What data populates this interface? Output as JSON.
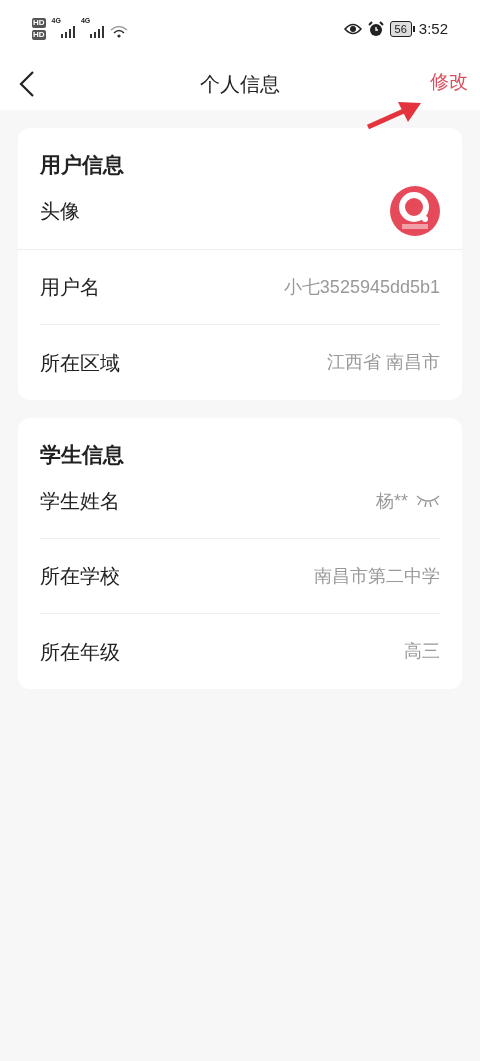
{
  "status_bar": {
    "sim_badges": [
      "HD",
      "HD"
    ],
    "networks": [
      "4G",
      "4G"
    ],
    "battery": "56",
    "time": "3:52"
  },
  "header": {
    "title": "个人信息",
    "action": "修改"
  },
  "sections": [
    {
      "title": "用户信息",
      "rows": [
        {
          "kind": "avatar",
          "label": "头像"
        },
        {
          "kind": "text",
          "label": "用户名",
          "value": "小七3525945dd5b1"
        },
        {
          "kind": "text",
          "label": "所在区域",
          "value": "江西省 南昌市"
        }
      ]
    },
    {
      "title": "学生信息",
      "rows": [
        {
          "kind": "masked",
          "label": "学生姓名",
          "value": "杨**",
          "revealed": false
        },
        {
          "kind": "text",
          "label": "所在学校",
          "value": "南昌市第二中学"
        },
        {
          "kind": "text",
          "label": "所在年级",
          "value": "高三"
        }
      ]
    }
  ]
}
